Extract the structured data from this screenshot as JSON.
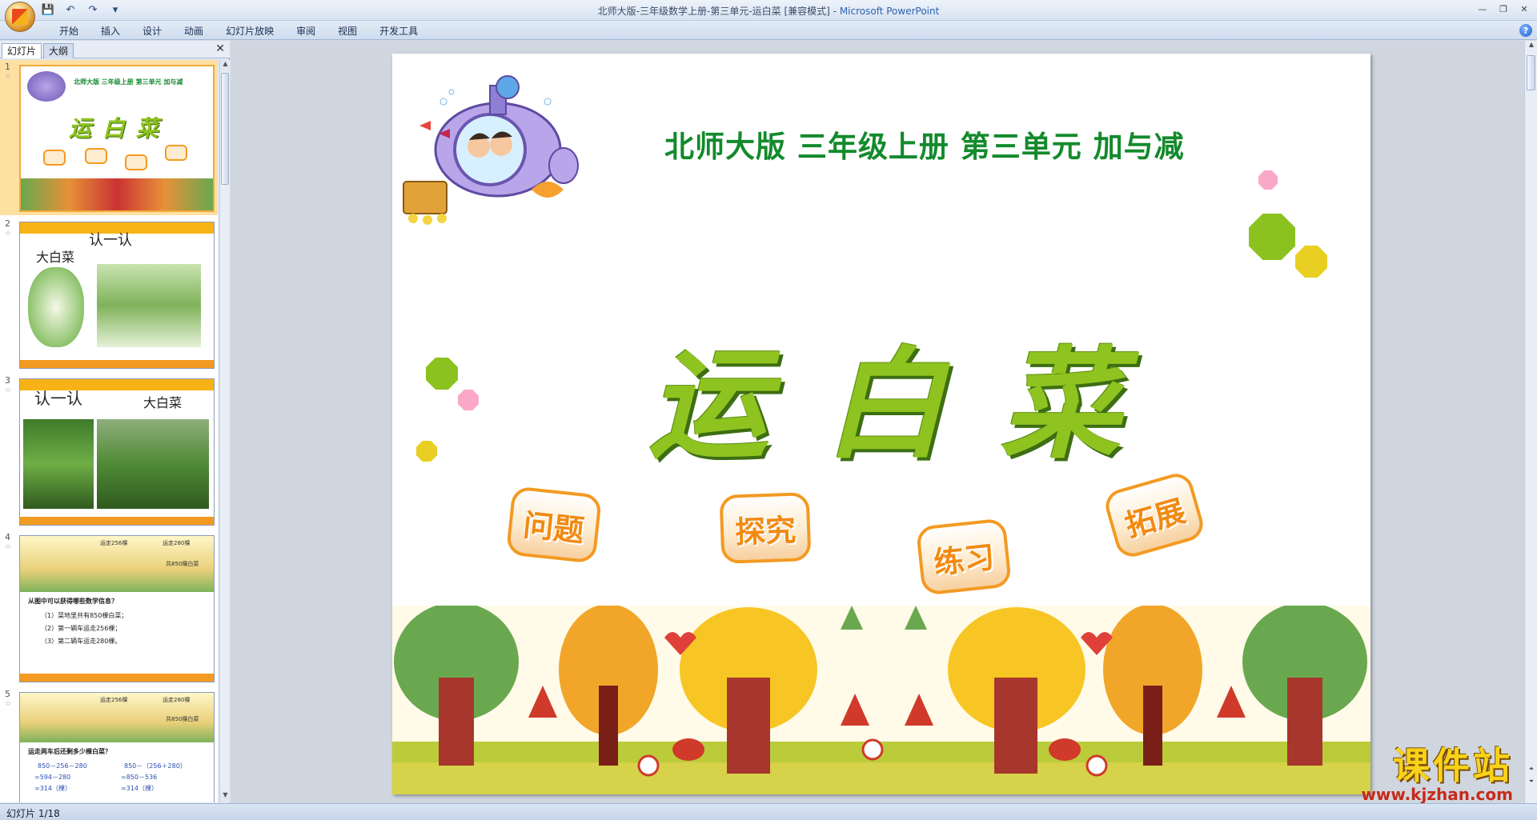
{
  "window": {
    "title_doc": "北师大版-三年级数学上册-第三单元-运白菜 [兼容模式] - ",
    "title_app": "Microsoft PowerPoint"
  },
  "ribbon": {
    "tabs": [
      "开始",
      "插入",
      "设计",
      "动画",
      "幻灯片放映",
      "审阅",
      "视图",
      "开发工具"
    ]
  },
  "left_panel": {
    "tab_slides": "幻灯片",
    "tab_outline": "大纲",
    "close": "✕"
  },
  "thumbnails": [
    {
      "num": "1",
      "selected": true
    },
    {
      "num": "2",
      "label_a": "认一认",
      "label_b": "大白菜"
    },
    {
      "num": "3",
      "label_a": "认一认",
      "label_b": "大白菜"
    },
    {
      "num": "4",
      "question": "从图中可以获得哪些数学信息？",
      "lines": [
        "（1）菜地里共有850棵白菜；",
        "（2）第一辆车运走256棵；",
        "（3）第二辆车运走280棵。"
      ],
      "tag_a": "运走256棵",
      "tag_b": "运走280棵",
      "tag_c": "共850棵白菜"
    },
    {
      "num": "5",
      "question": "运走两车后还剩多少棵白菜？",
      "lines_left": [
        "850－256－280",
        "=594－280",
        "=314（棵）"
      ],
      "lines_right": [
        "850－（256＋280）",
        "=850－536",
        "=314（棵）"
      ],
      "tag_a": "运走256棵",
      "tag_b": "运走280棵",
      "tag_c": "共850棵白菜"
    }
  ],
  "slide": {
    "subtitle": "北师大版  三年级上册  第三单元  加与减",
    "title": "运白菜",
    "badges": [
      "问题",
      "探究",
      "练习",
      "拓展"
    ],
    "colors": {
      "title_green": "#8fc31f",
      "subtitle_green": "#138a2c",
      "badge_orange": "#f39a22"
    }
  },
  "status": {
    "slide_count": "幻灯片 1/18"
  },
  "watermark": {
    "main": "课件站",
    "url": "www.kjzhan.com"
  }
}
